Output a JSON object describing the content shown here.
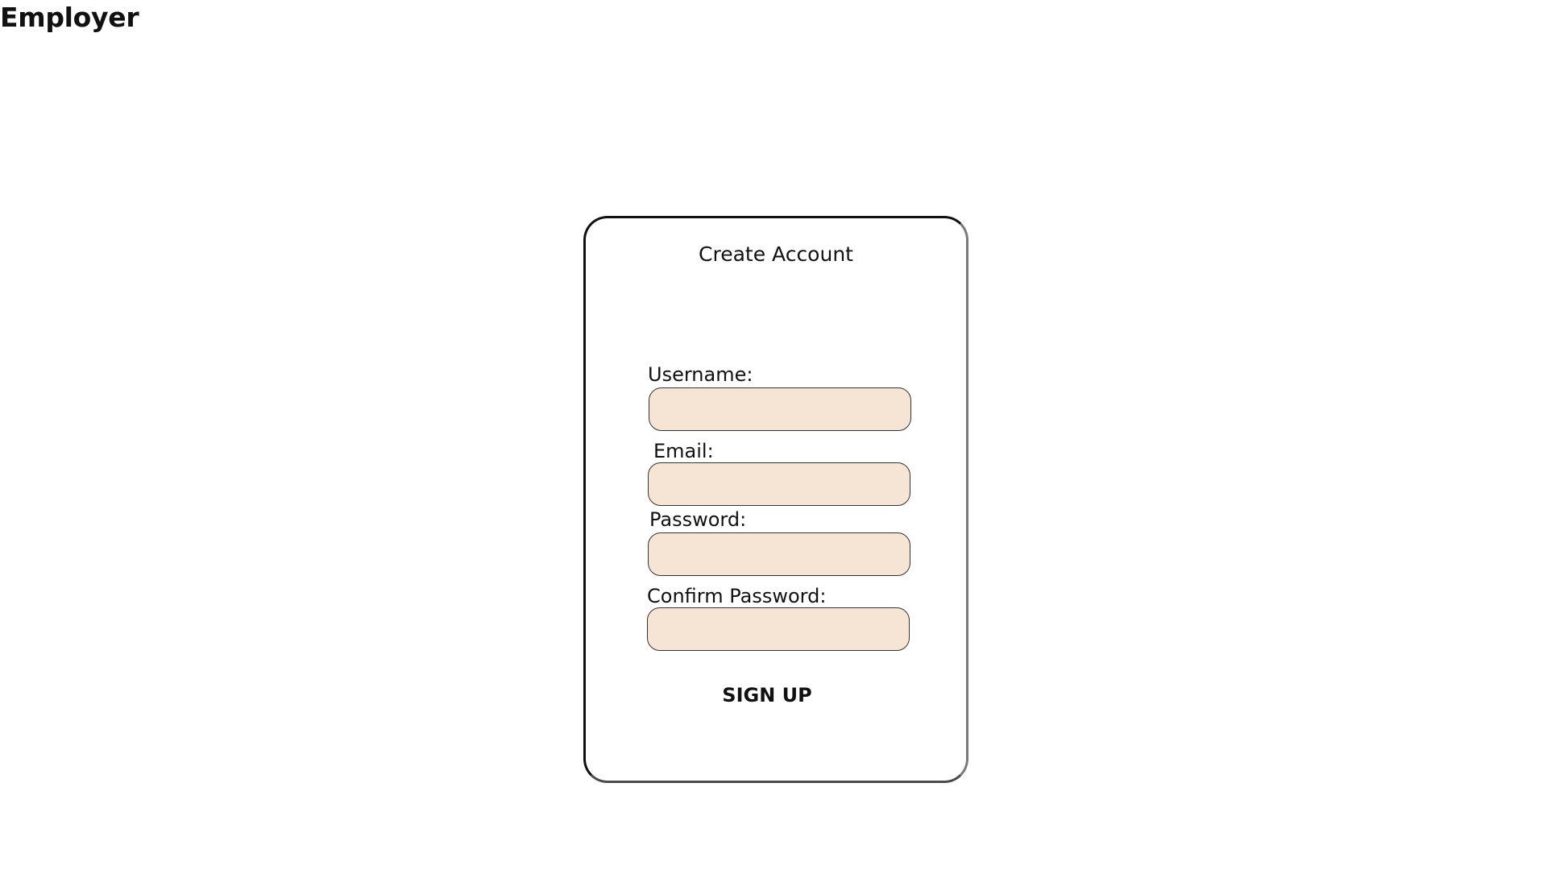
{
  "header": {
    "title": "Employer"
  },
  "form": {
    "title": "Create Account",
    "fields": [
      {
        "label": "Username:",
        "value": "",
        "placeholder": ""
      },
      {
        "label": "Email:",
        "value": "",
        "placeholder": ""
      },
      {
        "label": "Password:",
        "value": "",
        "placeholder": ""
      },
      {
        "label": "Confirm Password:",
        "value": "",
        "placeholder": ""
      }
    ],
    "submit_label": "SIGN UP"
  },
  "colors": {
    "input_fill": "#f6e4d5",
    "card_border": "#111111",
    "text": "#111111",
    "background": "#ffffff"
  }
}
